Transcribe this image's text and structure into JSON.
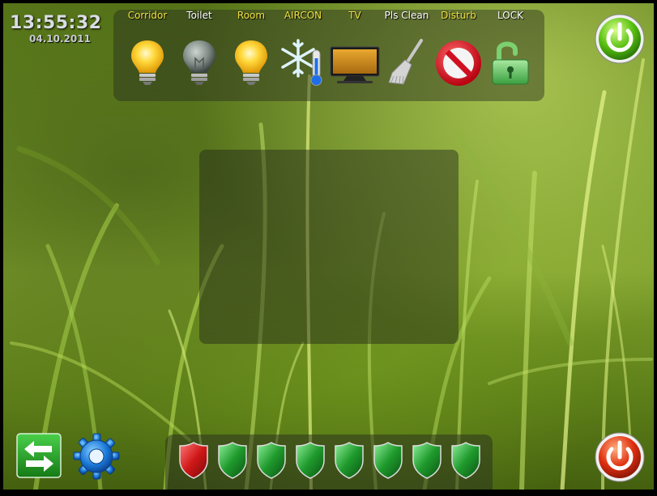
{
  "clock": {
    "time": "13:55:32",
    "date": "04.10.2011"
  },
  "controls": [
    {
      "label": "Corridor",
      "icon": "bulb-on-icon",
      "label_color": "#f0e040",
      "state": "on"
    },
    {
      "label": "Toilet",
      "icon": "bulb-off-icon",
      "label_color": "#ffffff",
      "state": "off"
    },
    {
      "label": "Room",
      "icon": "bulb-on-icon",
      "label_color": "#f0e040",
      "state": "on"
    },
    {
      "label": "AIRCON",
      "icon": "snowflake-thermometer-icon",
      "label_color": "#f0e040",
      "state": "on"
    },
    {
      "label": "TV",
      "icon": "tv-icon",
      "label_color": "#f0e040",
      "state": "on"
    },
    {
      "label": "Pls Clean",
      "icon": "broom-icon",
      "label_color": "#ffffff",
      "state": "off"
    },
    {
      "label": "Disturb",
      "icon": "do-not-disturb-icon",
      "label_color": "#f0e040",
      "state": "on"
    },
    {
      "label": "LOCK",
      "icon": "unlocked-padlock-icon",
      "label_color": "#ffffff",
      "state": "off"
    }
  ],
  "shields": [
    {
      "status": "red",
      "color": "#c81818"
    },
    {
      "status": "green",
      "color": "#1f9a2c"
    },
    {
      "status": "green",
      "color": "#1f9a2c"
    },
    {
      "status": "green",
      "color": "#1f9a2c"
    },
    {
      "status": "green",
      "color": "#1f9a2c"
    },
    {
      "status": "green",
      "color": "#1f9a2c"
    },
    {
      "status": "green",
      "color": "#1f9a2c"
    },
    {
      "status": "green",
      "color": "#1f9a2c"
    }
  ],
  "colors": {
    "active_label": "#f0e040",
    "inactive_label": "#ffffff",
    "power_on_green": "#58c010",
    "power_off_red": "#e03010",
    "settings_blue": "#1a78d8"
  }
}
